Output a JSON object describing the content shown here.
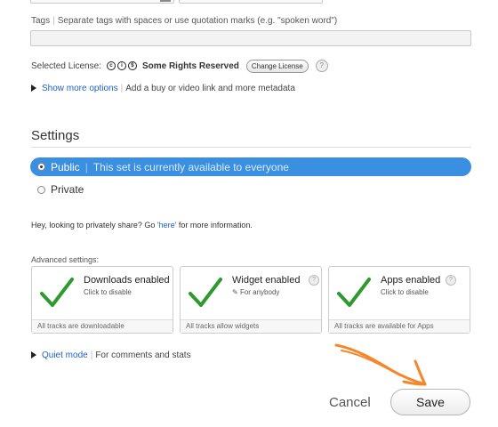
{
  "tags": {
    "label": "Tags",
    "hint": "Separate tags with spaces or use quotation marks (e.g. \"spoken word\")",
    "value": ""
  },
  "license": {
    "label": "Selected License:",
    "name": "Some Rights Reserved",
    "change_button": "Change License",
    "help": "?"
  },
  "show_more": {
    "link": "Show more options",
    "desc": "Add a buy or video link and more metadata"
  },
  "settings": {
    "title": "Settings",
    "public_label": "Public",
    "public_desc": "This set is currently available to everyone",
    "private_label": "Private",
    "selected": "public"
  },
  "share": {
    "prefix": "Hey, looking to privately share? Go",
    "link": "'here'",
    "suffix": "for more information."
  },
  "advanced": {
    "label": "Advanced settings:",
    "cards": [
      {
        "title": "Downloads enabled",
        "sub": "Click to disable",
        "footer": "All tracks are downloadable"
      },
      {
        "title": "Widget enabled",
        "sub": "For anybody",
        "footer": "All tracks allow widgets"
      },
      {
        "title": "Apps enabled",
        "sub": "Click to disable",
        "footer": "All tracks are available for Apps"
      }
    ]
  },
  "quiet": {
    "link": "Quiet mode",
    "desc": "For comments and stats"
  },
  "actions": {
    "cancel": "Cancel",
    "save": "Save"
  },
  "colors": {
    "accent": "#3b8fe0",
    "link": "#1f63c4",
    "check": "#2e9a2e",
    "annotation": "#f5862a"
  },
  "icons": {
    "license": [
      "cc-icon",
      "by-icon",
      "nc-icon"
    ],
    "widget_sub": "pencil-icon",
    "annotation": "orange-arrow"
  }
}
